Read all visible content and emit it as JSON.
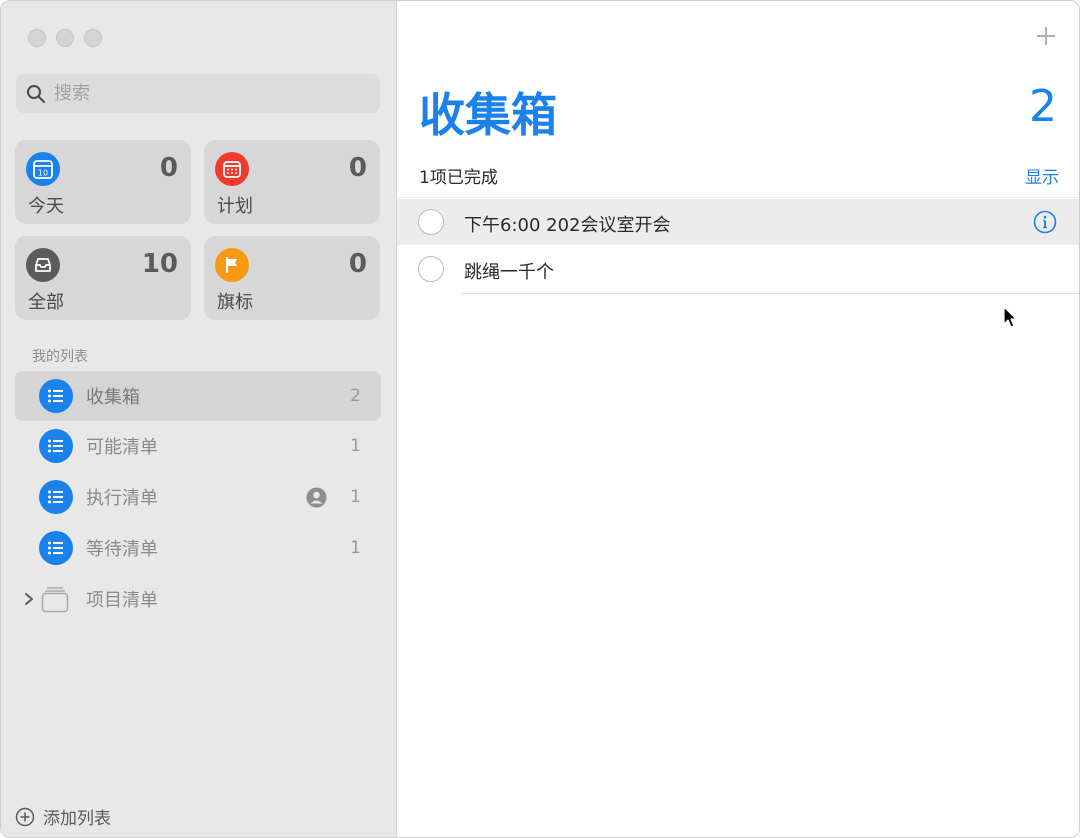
{
  "sidebar": {
    "search": {
      "placeholder": "搜索"
    },
    "smart_lists": [
      {
        "label": "今天",
        "count": "0",
        "icon": "calendar-today-icon",
        "color": "#1a82ea",
        "badge": "10"
      },
      {
        "label": "计划",
        "count": "0",
        "icon": "calendar-grid-icon",
        "color": "#f03a2e"
      },
      {
        "label": "全部",
        "count": "10",
        "icon": "tray-icon",
        "color": "#5b5b5b"
      },
      {
        "label": "旗标",
        "count": "0",
        "icon": "flag-icon",
        "color": "#f79a12"
      }
    ],
    "section_title": "我的列表",
    "lists": [
      {
        "label": "收集箱",
        "count": "2",
        "selected": true
      },
      {
        "label": "可能清单",
        "count": "1"
      },
      {
        "label": "执行清单",
        "count": "1",
        "shared": true
      },
      {
        "label": "等待清单",
        "count": "1"
      }
    ],
    "group": {
      "label": "项目清单"
    },
    "add_list_label": "添加列表"
  },
  "main": {
    "title": "收集箱",
    "count": "2",
    "completed_text": "1项已完成",
    "show_label": "显示",
    "tasks": [
      {
        "text": "下午6:00 202会议室开会",
        "highlighted": true
      },
      {
        "text": "跳绳一千个"
      }
    ]
  },
  "colors": {
    "accent": "#1a82ea",
    "sidebar_bg": "#e8e8e8"
  }
}
